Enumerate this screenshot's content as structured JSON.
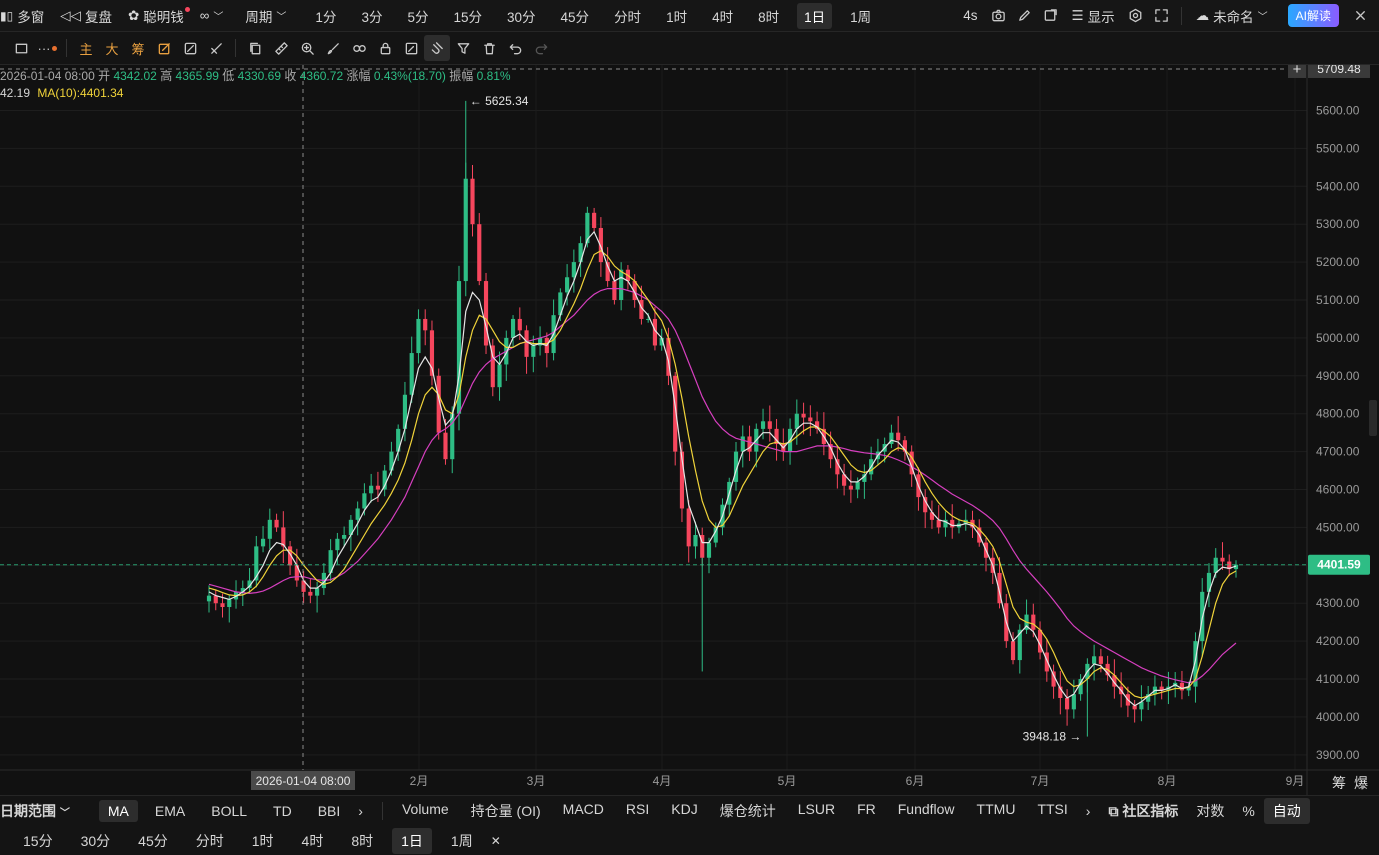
{
  "topbar": {
    "multiwin_label": "多窗",
    "replay_label": "复盘",
    "smartmoney_label": "聪明钱",
    "period_label": "周期",
    "intervals": [
      "1分",
      "3分",
      "5分",
      "15分",
      "30分",
      "45分",
      "分时",
      "1时",
      "4时",
      "8时",
      "1日",
      "1周"
    ],
    "active_interval": "1日",
    "refresh_label": "4s",
    "display_label": "显示",
    "layout_name": "未命名",
    "ai_label": "AI解读"
  },
  "toolbar": {
    "main_label": "主",
    "big_label": "大",
    "chip_label": "筹"
  },
  "info": {
    "date": "2026-01-04 08:00",
    "open_label": "开",
    "open": "4342.02",
    "high_label": "高",
    "high": "4365.99",
    "low_label": "低",
    "low": "4330.69",
    "close_label": "收",
    "close": "4360.72",
    "change_label": "涨幅",
    "change": "0.43%(18.70)",
    "amp_label": "振幅",
    "amp": "0.81%",
    "ma_prefix": "42.19",
    "ma10": "MA(10):4401.34"
  },
  "colors": {
    "up": "#2ebd85",
    "down": "#f6465d",
    "ma_white": "#e6e6e6",
    "ma_yellow": "#f0d33a",
    "ma_magenta": "#d63fbf",
    "background": "#111111"
  },
  "chart_data": {
    "type": "candlestick",
    "yticks": [
      3900,
      4000,
      4100,
      4200,
      4300,
      4400,
      4500,
      4600,
      4700,
      4800,
      4900,
      5000,
      5100,
      5200,
      5300,
      5400,
      5500,
      5600
    ],
    "ylim": [
      3860,
      5720
    ],
    "xticks": [
      "2月",
      "3月",
      "4月",
      "5月",
      "6月",
      "7月",
      "8月",
      "9月"
    ],
    "crosshair_date": "2026-01-04 08:00",
    "crosshair_price": "5709.48",
    "last_price": "4401.59",
    "max_annotation": "5625.34",
    "min_annotation": "3948.18",
    "closes": [
      4320,
      4300,
      4290,
      4310,
      4330,
      4340,
      4360,
      4450,
      4470,
      4520,
      4500,
      4450,
      4400,
      4360,
      4330,
      4320,
      4340,
      4380,
      4440,
      4470,
      4480,
      4520,
      4550,
      4590,
      4610,
      4600,
      4650,
      4700,
      4760,
      4850,
      4960,
      5050,
      5020,
      4900,
      4750,
      4680,
      4800,
      5150,
      5420,
      5300,
      5150,
      4980,
      4870,
      4930,
      5000,
      5050,
      5020,
      4950,
      4980,
      5000,
      4960,
      5060,
      5120,
      5160,
      5200,
      5250,
      5330,
      5290,
      5200,
      5150,
      5100,
      5180,
      5150,
      5100,
      5050,
      5050,
      4980,
      5000,
      4900,
      4700,
      4550,
      4450,
      4480,
      4420,
      4460,
      4500,
      4560,
      4620,
      4700,
      4740,
      4700,
      4760,
      4780,
      4760,
      4720,
      4700,
      4760,
      4800,
      4790,
      4780,
      4760,
      4720,
      4680,
      4640,
      4610,
      4600,
      4620,
      4640,
      4680,
      4700,
      4720,
      4750,
      4730,
      4700,
      4640,
      4580,
      4540,
      4520,
      4500,
      4520,
      4500,
      4510,
      4520,
      4500,
      4460,
      4420,
      4380,
      4300,
      4200,
      4150,
      4230,
      4270,
      4230,
      4170,
      4120,
      4080,
      4050,
      4020,
      4060,
      4100,
      4140,
      4160,
      4140,
      4110,
      4080,
      4060,
      4030,
      4020,
      4040,
      4060,
      4080,
      4070,
      4080,
      4090,
      4070,
      4080,
      4200,
      4330,
      4380,
      4420,
      4410,
      4390,
      4401.59
    ],
    "ma_white": [
      4330,
      4320,
      4315,
      4310,
      4318,
      4330,
      4345,
      4370,
      4400,
      4440,
      4460,
      4455,
      4430,
      4400,
      4360,
      4340,
      4340,
      4355,
      4380,
      4420,
      4450,
      4480,
      4510,
      4545,
      4570,
      4580,
      4610,
      4650,
      4700,
      4760,
      4840,
      4920,
      4950,
      4920,
      4840,
      4770,
      4790,
      4900,
      5070,
      5120,
      5100,
      5030,
      4950,
      4930,
      4960,
      5000,
      5010,
      4990,
      4980,
      4985,
      4980,
      5010,
      5060,
      5110,
      5150,
      5200,
      5260,
      5280,
      5240,
      5190,
      5150,
      5160,
      5150,
      5120,
      5080,
      5060,
      5020,
      5000,
      4940,
      4820,
      4680,
      4560,
      4510,
      4460,
      4460,
      4490,
      4530,
      4590,
      4650,
      4700,
      4710,
      4730,
      4750,
      4750,
      4730,
      4710,
      4730,
      4760,
      4775,
      4775,
      4765,
      4740,
      4710,
      4670,
      4640,
      4620,
      4620,
      4635,
      4660,
      4690,
      4710,
      4730,
      4725,
      4705,
      4660,
      4610,
      4570,
      4540,
      4520,
      4515,
      4505,
      4505,
      4510,
      4505,
      4480,
      4440,
      4400,
      4330,
      4250,
      4200,
      4220,
      4240,
      4225,
      4190,
      4150,
      4110,
      4075,
      4050,
      4060,
      4090,
      4120,
      4140,
      4135,
      4115,
      4090,
      4070,
      4045,
      4030,
      4040,
      4055,
      4070,
      4070,
      4075,
      4085,
      4075,
      4080,
      4150,
      4260,
      4330,
      4380,
      4395,
      4392,
      4398
    ],
    "ma_yellow": [
      4340,
      4335,
      4328,
      4322,
      4320,
      4322,
      4330,
      4345,
      4370,
      4400,
      4425,
      4440,
      4440,
      4425,
      4400,
      4380,
      4360,
      4350,
      4355,
      4370,
      4390,
      4420,
      4450,
      4480,
      4510,
      4535,
      4560,
      4590,
      4625,
      4670,
      4730,
      4800,
      4850,
      4870,
      4850,
      4810,
      4800,
      4850,
      4950,
      5020,
      5060,
      5050,
      5020,
      4990,
      4975,
      4975,
      4985,
      4990,
      4985,
      4985,
      4985,
      4995,
      5020,
      5055,
      5090,
      5130,
      5180,
      5220,
      5230,
      5215,
      5190,
      5175,
      5165,
      5150,
      5125,
      5100,
      5070,
      5045,
      5000,
      4930,
      4840,
      4740,
      4650,
      4570,
      4520,
      4500,
      4505,
      4530,
      4570,
      4610,
      4640,
      4670,
      4700,
      4720,
      4725,
      4720,
      4725,
      4740,
      4755,
      4765,
      4765,
      4755,
      4740,
      4715,
      4690,
      4665,
      4650,
      4645,
      4650,
      4665,
      4680,
      4700,
      4710,
      4705,
      4685,
      4655,
      4620,
      4590,
      4565,
      4545,
      4530,
      4520,
      4515,
      4510,
      4495,
      4475,
      4450,
      4410,
      4350,
      4290,
      4260,
      4250,
      4245,
      4230,
      4205,
      4170,
      4130,
      4095,
      4080,
      4085,
      4100,
      4120,
      4130,
      4125,
      4110,
      4090,
      4070,
      4055,
      4050,
      4055,
      4060,
      4065,
      4070,
      4075,
      4075,
      4078,
      4100,
      4160,
      4230,
      4300,
      4350,
      4375,
      4385
    ],
    "ma_magenta": [
      4350,
      4345,
      4340,
      4335,
      4330,
      4328,
      4326,
      4328,
      4332,
      4340,
      4350,
      4360,
      4368,
      4370,
      4370,
      4365,
      4362,
      4360,
      4362,
      4370,
      4380,
      4395,
      4410,
      4430,
      4450,
      4470,
      4495,
      4520,
      4550,
      4580,
      4620,
      4660,
      4700,
      4730,
      4750,
      4760,
      4775,
      4800,
      4840,
      4880,
      4910,
      4930,
      4945,
      4955,
      4965,
      4975,
      4985,
      4990,
      4995,
      5000,
      5005,
      5015,
      5030,
      5045,
      5060,
      5080,
      5100,
      5115,
      5125,
      5130,
      5130,
      5130,
      5125,
      5120,
      5110,
      5100,
      5085,
      5070,
      5050,
      5020,
      4980,
      4935,
      4890,
      4845,
      4810,
      4780,
      4760,
      4745,
      4735,
      4730,
      4725,
      4720,
      4715,
      4710,
      4705,
      4700,
      4700,
      4700,
      4705,
      4710,
      4715,
      4715,
      4715,
      4712,
      4708,
      4703,
      4700,
      4697,
      4695,
      4693,
      4690,
      4685,
      4678,
      4670,
      4660,
      4650,
      4638,
      4625,
      4612,
      4600,
      4588,
      4578,
      4568,
      4558,
      4546,
      4533,
      4518,
      4498,
      4470,
      4440,
      4412,
      4390,
      4370,
      4350,
      4330,
      4308,
      4285,
      4260,
      4240,
      4225,
      4212,
      4200,
      4190,
      4180,
      4170,
      4160,
      4150,
      4140,
      4130,
      4122,
      4115,
      4108,
      4103,
      4098,
      4094,
      4090,
      4095,
      4108,
      4125,
      4145,
      4165,
      4180,
      4195
    ]
  },
  "bottom": {
    "date_range_label": "日期范围",
    "indicators_main": [
      "MA",
      "EMA",
      "BOLL",
      "TD",
      "BBI"
    ],
    "active_main": "MA",
    "indicators_sub": [
      "Volume",
      "持仓量 (OI)",
      "MACD",
      "RSI",
      "KDJ",
      "爆仓统计",
      "LSUR",
      "FR",
      "Fundflow",
      "TTMU",
      "TTSI"
    ],
    "community_label": "社区指标",
    "log_label": "对数",
    "pct_label": "%",
    "auto_label": "自动",
    "chip_label": "筹",
    "burst_label": "爆",
    "intervals": [
      "15分",
      "30分",
      "45分",
      "分时",
      "1时",
      "4时",
      "8时",
      "1日",
      "1周"
    ],
    "active_interval": "1日"
  }
}
